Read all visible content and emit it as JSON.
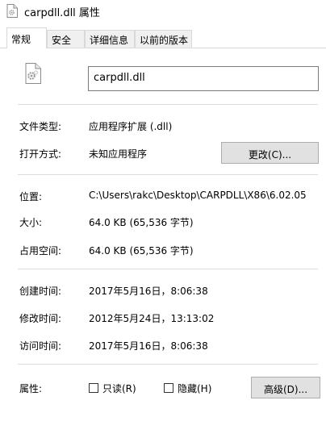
{
  "window": {
    "title": "carpdll.dll 属性",
    "icon": "gear-file-icon"
  },
  "tabs": [
    {
      "label": "常规",
      "active": true
    },
    {
      "label": "安全",
      "active": false
    },
    {
      "label": "详细信息",
      "active": false
    },
    {
      "label": "以前的版本",
      "active": false
    }
  ],
  "general": {
    "file_icon": "gear-file-icon",
    "file_name": "carpdll.dll",
    "file_type_label": "文件类型:",
    "file_type_value": "应用程序扩展 (.dll)",
    "opens_with_label": "打开方式:",
    "opens_with_value": "未知应用程序",
    "change_button": "更改(C)...",
    "location_label": "位置:",
    "location_value": "C:\\Users\\rakc\\Desktop\\CARPDLL\\X86\\6.02.05",
    "size_label": "大小:",
    "size_value": "64.0 KB (65,536 字节)",
    "size_on_disk_label": "占用空间:",
    "size_on_disk_value": "64.0 KB (65,536 字节)",
    "created_label": "创建时间:",
    "created_value": "2017年5月16日，8:06:38",
    "modified_label": "修改时间:",
    "modified_value": "2012年5月24日，13:13:02",
    "accessed_label": "访问时间:",
    "accessed_value": "2017年5月16日，8:06:38",
    "attributes_label": "属性:",
    "readonly_label": "只读(R)",
    "readonly_checked": false,
    "hidden_label": "隐藏(H)",
    "hidden_checked": false,
    "advanced_button": "高级(D)..."
  }
}
